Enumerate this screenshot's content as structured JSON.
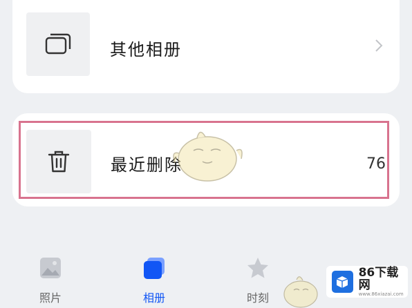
{
  "albums": {
    "other": {
      "label": "其他相册",
      "icon": "album-stack-icon"
    },
    "recently_deleted": {
      "label": "最近删除",
      "count": "76",
      "icon": "trash-icon"
    }
  },
  "tabbar": {
    "tabs": [
      {
        "label": "照片",
        "icon": "photo-icon",
        "active": false
      },
      {
        "label": "相册",
        "icon": "album-icon",
        "active": true
      },
      {
        "label": "时刻",
        "icon": "star-icon",
        "active": false
      }
    ]
  },
  "watermark": {
    "name": "86下载网",
    "url": "www.86xiazai.com"
  },
  "colors": {
    "accent": "#1156f5",
    "highlight": "#d8738e",
    "inactive_tab": "#666666"
  }
}
